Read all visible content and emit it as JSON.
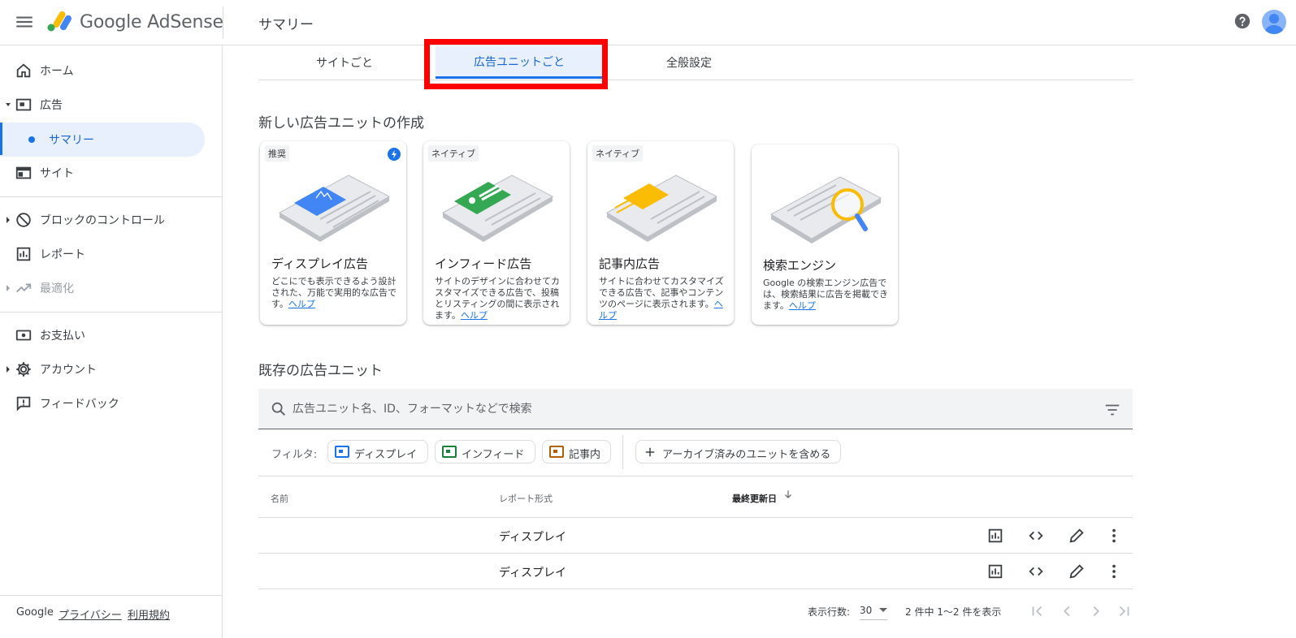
{
  "app": {
    "logo_text": "Google AdSense",
    "page_title": "サマリー",
    "brand_colors": {
      "blue": "#4285f4",
      "yellow": "#fbbc04",
      "green": "#34a853",
      "accent": "#1a73e8"
    }
  },
  "sidebar": {
    "items": [
      {
        "label": "ホーム",
        "icon": "home-icon"
      },
      {
        "label": "広告",
        "icon": "ad-icon"
      },
      {
        "label": "サマリー",
        "icon": "dot"
      },
      {
        "label": "サイト",
        "icon": "site-icon"
      },
      {
        "label": "ブロックのコントロール",
        "icon": "block-icon"
      },
      {
        "label": "レポート",
        "icon": "report-icon"
      },
      {
        "label": "最適化",
        "icon": "trending-icon"
      },
      {
        "label": "お支払い",
        "icon": "payment-icon"
      },
      {
        "label": "アカウント",
        "icon": "gear-icon"
      },
      {
        "label": "フィードバック",
        "icon": "feedback-icon"
      }
    ],
    "footer": {
      "brand": "Google",
      "privacy": "プライバシー",
      "terms": "利用規約"
    }
  },
  "tabs": [
    {
      "label": "サイトごと"
    },
    {
      "label": "広告ユニットごと"
    },
    {
      "label": "全般設定"
    }
  ],
  "create": {
    "heading": "新しい広告ユニットの作成",
    "cards": [
      {
        "badge": "推奨",
        "title": "ディスプレイ広告",
        "desc": "どこにでも表示できるよう設計された、万能で実用的な広告です。",
        "help": "ヘルプ"
      },
      {
        "badge": "ネイティブ",
        "title": "インフィード広告",
        "desc": "サイトのデザインに合わせてカスタマイズできる広告で、投稿とリスティングの間に表示されます。",
        "help": "ヘルプ"
      },
      {
        "badge": "ネイティブ",
        "title": "記事内広告",
        "desc": "サイトに合わせてカスタマイズできる広告で、記事やコンテンツのページに表示されます。",
        "help": "ヘルプ"
      },
      {
        "badge": "",
        "title": "検索エンジン",
        "desc": "Google の検索エンジン広告では、検索結果に広告を掲載できます。",
        "help": "ヘルプ"
      }
    ]
  },
  "existing": {
    "heading": "既存の広告ユニット",
    "search_placeholder": "広告ユニット名、ID、フォーマットなどで検索",
    "filter_label": "フィルタ:",
    "chips": [
      {
        "label": "ディスプレイ",
        "color": "#1a73e8"
      },
      {
        "label": "インフィード",
        "color": "#188038"
      },
      {
        "label": "記事内",
        "color": "#b06000"
      }
    ],
    "archive_chip": "アーカイブ済みのユニットを含める",
    "columns": {
      "name": "名前",
      "format": "レポート形式",
      "updated": "最終更新日"
    },
    "rows": [
      {
        "format": "ディスプレイ"
      },
      {
        "format": "ディスプレイ"
      }
    ],
    "pager": {
      "rows_label": "表示行数:",
      "rows_value": "30",
      "range": "2 件中 1〜2 件を表示"
    }
  }
}
